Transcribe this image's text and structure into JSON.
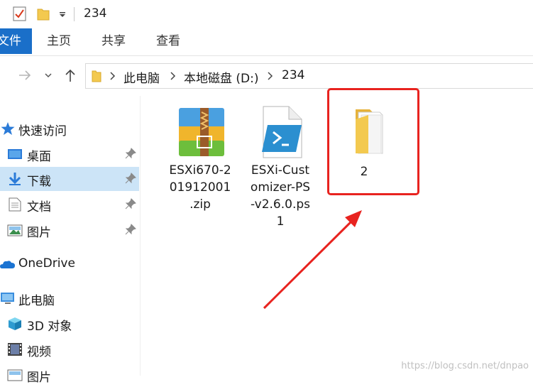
{
  "titlebar": {
    "title": "234"
  },
  "ribbon": {
    "file": "文件",
    "home": "主页",
    "share": "共享",
    "view": "查看"
  },
  "address": {
    "crumbs": [
      "此电脑",
      "本地磁盘 (D:)",
      "234"
    ]
  },
  "sidebar": {
    "items": [
      {
        "label": "快速访问"
      },
      {
        "label": "桌面"
      },
      {
        "label": "下载"
      },
      {
        "label": "文档"
      },
      {
        "label": "图片"
      },
      {
        "label": "OneDrive"
      },
      {
        "label": "此电脑"
      },
      {
        "label": "3D 对象"
      },
      {
        "label": "视频"
      },
      {
        "label": "图片"
      }
    ]
  },
  "files": [
    {
      "name": "ESXi670-201912001.zip",
      "line1": "ESXi670-2",
      "line2": "01912001",
      "line3": ".zip",
      "icon": "zip-archive-icon"
    },
    {
      "name": "ESXi-Customizer-PS-v2.6.0.ps1",
      "line1": "ESXi-Cust",
      "line2": "omizer-PS",
      "line3": "-v2.6.0.ps",
      "line4": "1",
      "icon": "powershell-script-icon"
    },
    {
      "name": "2",
      "line1": "2",
      "icon": "folder-icon"
    }
  ],
  "watermark": "https://blog.csdn.net/dnpao",
  "colors": {
    "accent": "#1a6fc9",
    "selected": "#cce4f7",
    "highlight": "#e8231f",
    "folder": "#f3c94f"
  }
}
